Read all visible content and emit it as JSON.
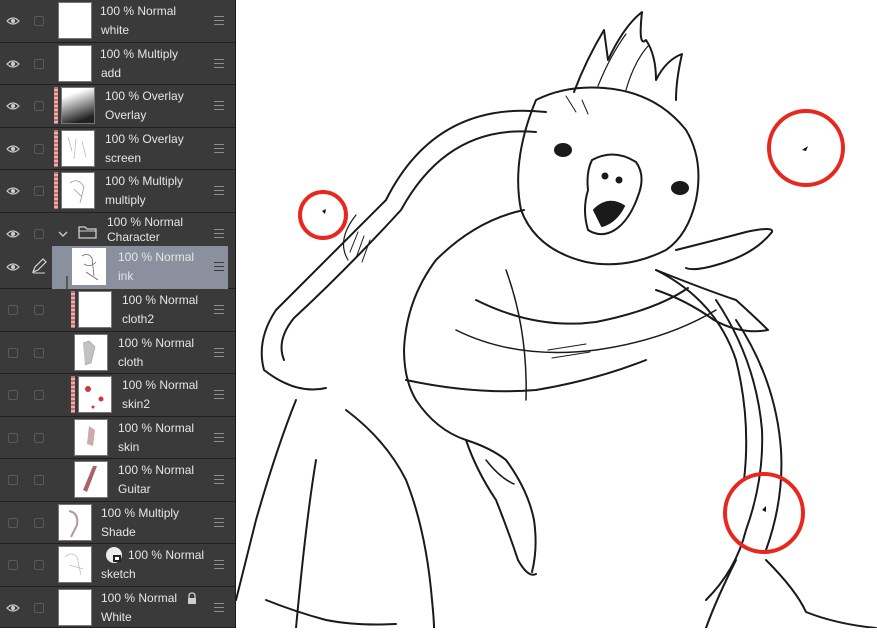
{
  "layers": [
    {
      "opacity": "100 %",
      "blend": "Normal",
      "name": "white",
      "visible": true
    },
    {
      "opacity": "100 %",
      "blend": "Multiply",
      "name": "add",
      "visible": true
    },
    {
      "opacity": "100 %",
      "blend": "Overlay",
      "name": "Overlay",
      "visible": true
    },
    {
      "opacity": "100 %",
      "blend": "Overlay",
      "name": "screen",
      "visible": true
    },
    {
      "opacity": "100 %",
      "blend": "Multiply",
      "name": "multiply",
      "visible": true
    },
    {
      "opacity": "100 %",
      "blend": "Normal",
      "name": "Character",
      "visible": true,
      "type": "folder"
    },
    {
      "opacity": "100 %",
      "blend": "Normal",
      "name": "ink",
      "visible": true,
      "selected": true
    },
    {
      "opacity": "100 %",
      "blend": "Normal",
      "name": "cloth2",
      "visible": false
    },
    {
      "opacity": "100 %",
      "blend": "Normal",
      "name": "cloth",
      "visible": false
    },
    {
      "opacity": "100 %",
      "blend": "Normal",
      "name": "skin2",
      "visible": false
    },
    {
      "opacity": "100 %",
      "blend": "Normal",
      "name": "skin",
      "visible": false
    },
    {
      "opacity": "100 %",
      "blend": "Normal",
      "name": "Guitar",
      "visible": false
    },
    {
      "opacity": "100 %",
      "blend": "Multiply",
      "name": "Shade",
      "visible": false
    },
    {
      "opacity": "100 %",
      "blend": "Normal",
      "name": "sketch",
      "visible": false
    },
    {
      "opacity": "100 %",
      "blend": "Normal",
      "name": "White",
      "visible": true,
      "locked": true
    }
  ],
  "canvas": {
    "subject": "cockatoo character line art",
    "highlight_color": "#e8281e"
  },
  "colors": {
    "panel_bg": "#2b2b2b",
    "row_bg": "#3a3a3a",
    "selected_bg": "#8a909e",
    "text": "#e6e6e6"
  }
}
